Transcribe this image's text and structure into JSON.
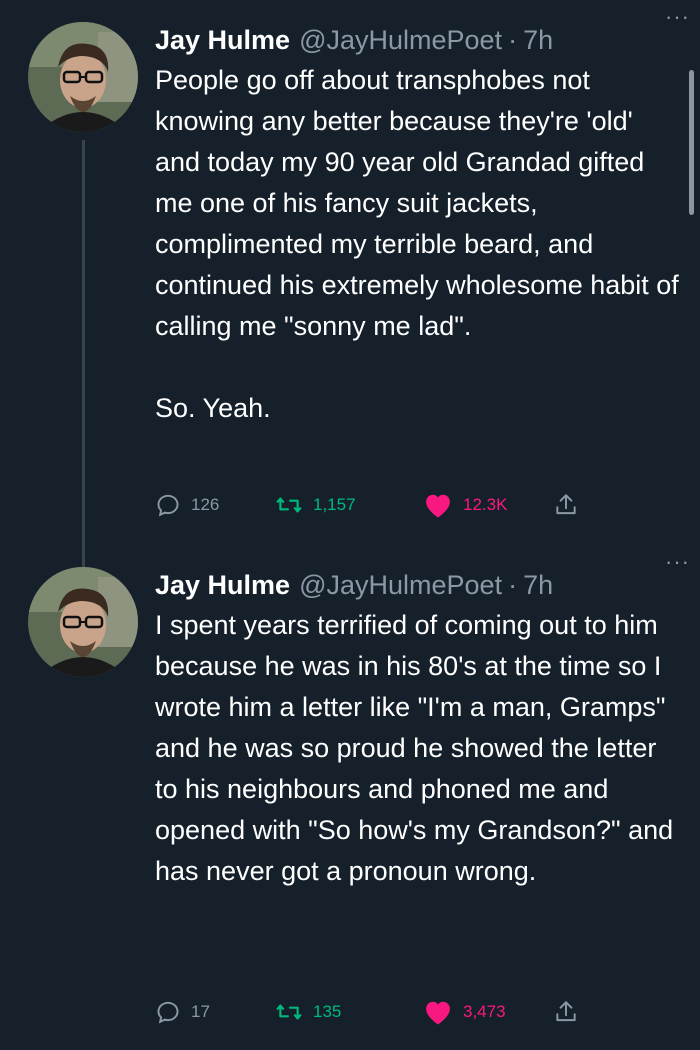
{
  "tweets": [
    {
      "name": "Jay Hulme",
      "handle": "@JayHulmePoet",
      "separator": "·",
      "time": "7h",
      "more": "···",
      "paragraphs": [
        "People go off about transphobes not knowing any better because they're 'old' and today my 90 year old Grandad gifted me one of his fancy suit jackets, complimented my terrible beard, and continued his extremely wholesome habit of calling me \"sonny me lad\".",
        "So. Yeah."
      ],
      "replies": "126",
      "retweets": "1,157",
      "likes": "12.3K"
    },
    {
      "name": "Jay Hulme",
      "handle": "@JayHulmePoet",
      "separator": "·",
      "time": "7h",
      "more": "···",
      "paragraphs": [
        "I spent years terrified of coming out to him because he was in his 80's at the time so I wrote him a letter like \"I'm a man, Gramps\" and he was so proud he showed the letter to his neighbours and phoned me and opened with \"So how's my Grandson?\" and has never got a pronoun wrong."
      ],
      "replies": "17",
      "retweets": "135",
      "likes": "3,473"
    }
  ],
  "colors": {
    "background": "#15202b",
    "text": "#ffffff",
    "secondary": "#8b98a5",
    "retweet": "#00ba7c",
    "like": "#f91880"
  },
  "icons": [
    "reply-icon",
    "retweet-icon",
    "heart-icon",
    "share-icon",
    "more-icon"
  ]
}
